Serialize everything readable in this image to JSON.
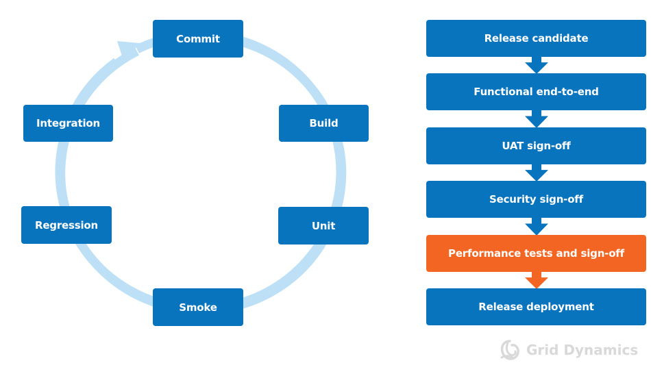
{
  "colors": {
    "box_blue": "#0874be",
    "box_orange": "#f26522",
    "cycle_ring": "#bde0f6",
    "logo_gray": "#d9d9d9",
    "text_white": "#ffffff"
  },
  "cycle": {
    "direction": "clockwise",
    "stages": [
      {
        "id": "commit",
        "label": "Commit"
      },
      {
        "id": "build",
        "label": "Build"
      },
      {
        "id": "unit",
        "label": "Unit"
      },
      {
        "id": "smoke",
        "label": "Smoke"
      },
      {
        "id": "regression",
        "label": "Regression"
      },
      {
        "id": "integration",
        "label": "Integration"
      }
    ],
    "arrowhead_points_to": "Commit"
  },
  "pipeline": {
    "steps": [
      {
        "label": "Release candidate",
        "highlight": false
      },
      {
        "label": "Functional end-to-end",
        "highlight": false
      },
      {
        "label": "UAT sign-off",
        "highlight": false
      },
      {
        "label": "Security sign-off",
        "highlight": false
      },
      {
        "label": "Performance tests and sign-off",
        "highlight": true
      },
      {
        "label": "Release deployment",
        "highlight": false
      }
    ]
  },
  "logo": {
    "text": "Grid Dynamics",
    "icon": "grid-dynamics-logo-icon"
  }
}
